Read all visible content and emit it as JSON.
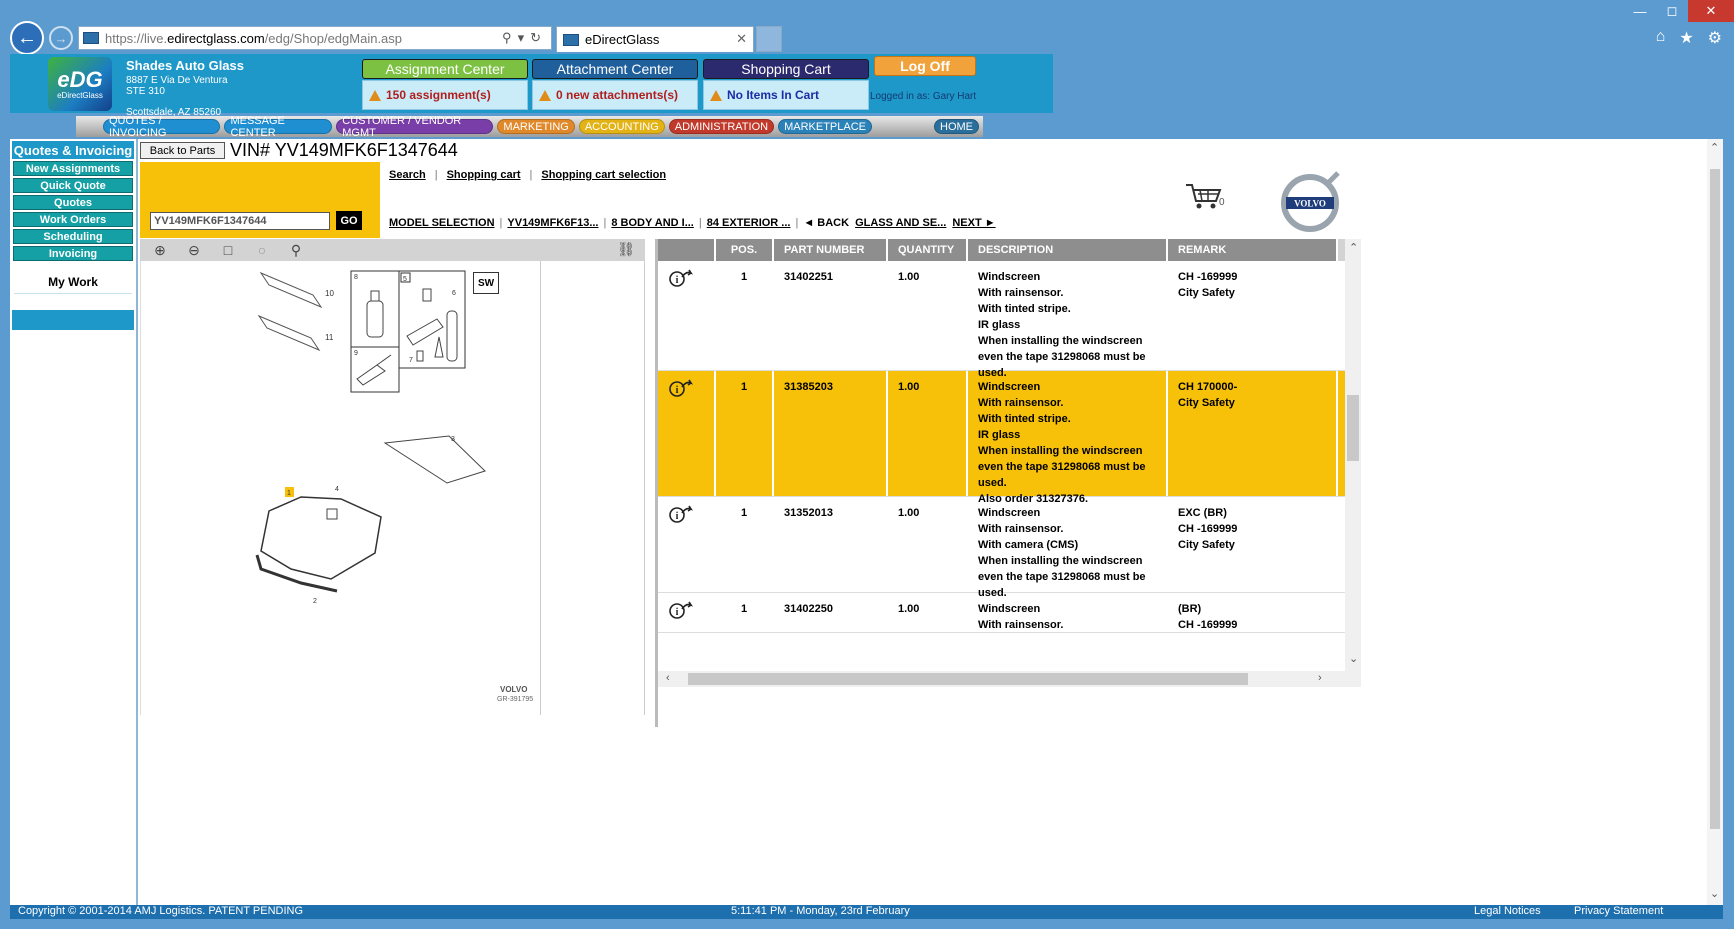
{
  "browser": {
    "url_prefix": "https://live.",
    "url_domain": "edirectglass.com",
    "url_path": "/edg/Shop/edgMain.asp",
    "tab_title": "eDirectGlass"
  },
  "header": {
    "logo_main": "eDG",
    "logo_sub": "eDirectGlass",
    "company_name": "Shades Auto Glass",
    "address_line1": "8887 E Via De Ventura",
    "address_line2": "STE 310",
    "address_city": "Scottsdale, AZ 85260",
    "assignment_center_label": "Assignment Center",
    "assignment_status": "150 assignment(s)",
    "attachment_center_label": "Attachment Center",
    "attachment_status": "0 new attachments(s)",
    "shopping_cart_label": "Shopping Cart",
    "cart_status": "No Items In Cart",
    "logoff_label": "Log Off",
    "logged_in_as": "Logged in as: Gary Hart"
  },
  "nav": [
    {
      "label": "QUOTES / INVOICING",
      "color": "#1f8fd1"
    },
    {
      "label": "MESSAGE CENTER",
      "color": "#1f8fd1"
    },
    {
      "label": "CUSTOMER / VENDOR MGMT",
      "color": "#7a3ea8"
    },
    {
      "label": "MARKETING",
      "color": "#e0892a"
    },
    {
      "label": "ACCOUNTING",
      "color": "#e3b316"
    },
    {
      "label": "ADMINISTRATION",
      "color": "#c0392b"
    },
    {
      "label": "MARKETPLACE",
      "color": "#2a82b8"
    },
    {
      "label": "HOME",
      "color": "#2a6f9c"
    }
  ],
  "left_panel": {
    "title": "Quotes & Invoicing",
    "items": [
      "New Assignments",
      "Quick Quote",
      "Quotes",
      "Work Orders",
      "Scheduling",
      "Invoicing"
    ],
    "my_work": "My Work"
  },
  "content": {
    "back_to_parts": "Back to Parts",
    "vin_title": "VIN# YV149MFK6F1347644",
    "vin_input_value": "YV149MFK6F1347644",
    "go_label": "GO",
    "links": [
      "Search",
      "Shopping cart",
      "Shopping cart selection"
    ],
    "breadcrumb": [
      "MODEL SELECTION",
      "YV149MFK6F13...",
      "8 BODY AND I...",
      "84 EXTERIOR ...",
      "◄ BACK",
      "GLASS AND SE...",
      "NEXT ►"
    ],
    "cart_count": "0",
    "brand": "VOLVO"
  },
  "diagram": {
    "sw_label": "SW",
    "brand_text": "VOLVO",
    "code": "GR-391795",
    "labels": [
      "10",
      "11",
      "8",
      "5",
      "6",
      "9",
      "7",
      "3",
      "4",
      "1",
      "2"
    ]
  },
  "table": {
    "headers": {
      "pos": "POS.",
      "part": "PART NUMBER",
      "qty": "QUANTITY",
      "desc": "DESCRIPTION",
      "remark": "REMARK"
    },
    "rows": [
      {
        "pos": "1",
        "part": "31402251",
        "qty": "1.00",
        "desc": "Windscreen\nWith rainsensor.\nWith tinted stripe.\nIR glass\nWhen installing the windscreen\neven the tape 31298068 must be\nused.",
        "remark": "CH -169999\nCity Safety",
        "selected": false
      },
      {
        "pos": "1",
        "part": "31385203",
        "qty": "1.00",
        "desc": "Windscreen\nWith rainsensor.\nWith tinted stripe.\nIR glass\nWhen installing the windscreen\neven the tape 31298068 must be\nused.\nAlso order 31327376.",
        "remark": "CH 170000-\nCity Safety",
        "selected": true
      },
      {
        "pos": "1",
        "part": "31352013",
        "qty": "1.00",
        "desc": "Windscreen\nWith rainsensor.\nWith camera (CMS)\nWhen installing the windscreen\neven the tape 31298068 must be\nused.",
        "remark": "EXC (BR)\nCH -169999\nCity Safety",
        "selected": false
      },
      {
        "pos": "1",
        "part": "31402250",
        "qty": "1.00",
        "desc": "Windscreen\nWith rainsensor.",
        "remark": "(BR)\nCH -169999",
        "selected": false
      }
    ]
  },
  "footer": {
    "copyright": "Copyright © 2001-2014 AMJ Logistics. PATENT PENDING",
    "datetime": "5:11:41 PM - Monday, 23rd February",
    "legal": "Legal Notices",
    "privacy": "Privacy Statement"
  }
}
